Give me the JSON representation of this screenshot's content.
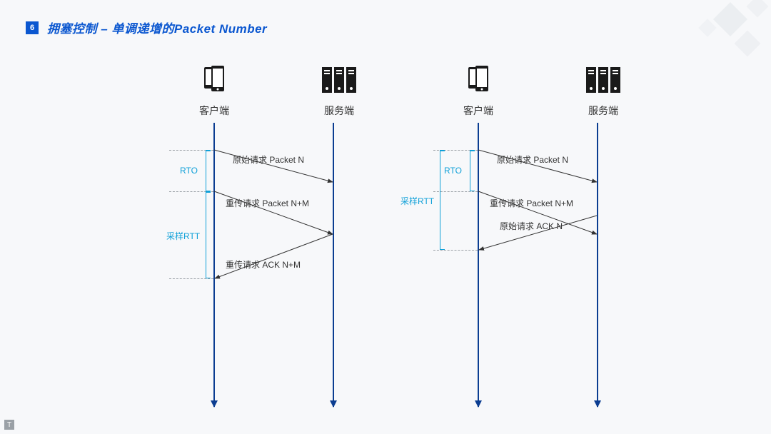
{
  "page_number": "6",
  "title": "拥塞控制 – 单调递增的Packet Number",
  "nodes": {
    "client": "客户端",
    "server": "服务端"
  },
  "brackets": {
    "rto": "RTO",
    "sample_rtt": "采样RTT"
  },
  "left_diagram": {
    "msg1": "原始请求 Packet N",
    "msg2": "重传请求 Packet N+M",
    "msg3": "重传请求 ACK N+M"
  },
  "right_diagram": {
    "msg1": "原始请求 Packet N",
    "msg2": "重传请求 Packet N+M",
    "msg3": "原始请求 ACK N"
  },
  "colors": {
    "accent": "#0B57D0",
    "lifeline": "#0B3D91",
    "bracket": "#0FA0D8"
  }
}
